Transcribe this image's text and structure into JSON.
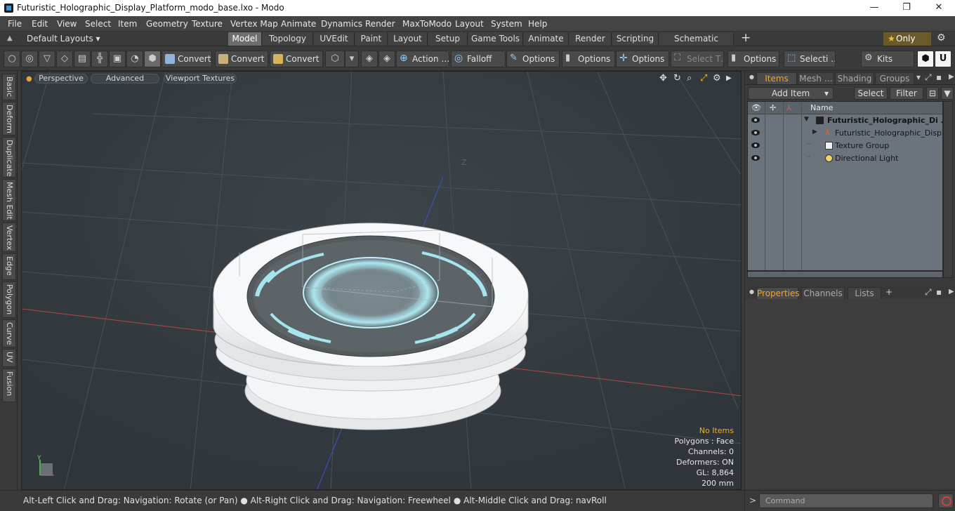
{
  "window": {
    "title": "Futuristic_Holographic_Display_Platform_modo_base.lxo - Modo",
    "minimize": "—",
    "restore": "❐",
    "close": "✕"
  },
  "menu": [
    "File",
    "Edit",
    "View",
    "Select",
    "Item",
    "Geometry",
    "Texture",
    "Vertex Map",
    "Animate",
    "Dynamics",
    "Render",
    "MaxToModo",
    "Layout",
    "System",
    "Help"
  ],
  "layout_bar": {
    "layouts_label": "Default Layouts ▾",
    "tabs": [
      "Model",
      "Topology",
      "UVEdit",
      "Paint",
      "Layout",
      "Setup",
      "Game Tools",
      "Animate",
      "Render",
      "Scripting",
      "Schematic Fusion"
    ],
    "active_tab": "Model",
    "add": "+",
    "only_label": "Only",
    "star": "★",
    "gear": "⚙"
  },
  "toolbar": {
    "buttons": [
      "Convert",
      "Convert",
      "Convert",
      "Action …",
      "Falloff",
      "Options",
      "Options",
      "Options",
      "Select T…",
      "Options",
      "Selecti …",
      "Kits"
    ]
  },
  "left_tabs": [
    "Basic",
    "Deform",
    "Duplicate",
    "Mesh Edit",
    "Vertex",
    "Edge",
    "Polygon",
    "Curve",
    "UV",
    "Fusion"
  ],
  "viewport": {
    "tabs": [
      "Perspective",
      "Advanced",
      "Viewport Textures"
    ],
    "axis_z_label": "Z",
    "axis_y_label": "Y",
    "info": {
      "no_items": "No Items",
      "polygons": "Polygons : Face",
      "channels": "Channels: 0",
      "deformers": "Deformers: ON",
      "gl": "GL: 8,864",
      "scale": "200 mm"
    }
  },
  "status_bar": "Alt-Left Click and Drag: Navigation: Rotate (or Pan) ● Alt-Right Click and Drag: Navigation: Freewheel ● Alt-Middle Click and Drag: navRoll",
  "items_panel": {
    "tabs": [
      "Items",
      "Mesh …",
      "Shading",
      "Groups"
    ],
    "active_tab": "Items",
    "add_item": "Add Item",
    "select": "Select",
    "filter": "Filter",
    "column_name": "Name",
    "rows": [
      {
        "name": "Futuristic_Holographic_Di …",
        "bold": true
      },
      {
        "name": "Futuristic_Holographic_Displ …",
        "bold": false
      },
      {
        "name": "Texture Group",
        "bold": false
      },
      {
        "name": "Directional Light",
        "bold": false
      }
    ]
  },
  "properties_panel": {
    "tabs": [
      "Properties",
      "Channels",
      "Lists"
    ],
    "active_tab": "Properties",
    "add": "+"
  },
  "command": {
    "prompt": ">",
    "placeholder": "Command"
  },
  "colors": {
    "accent_orange": "#f2a52a",
    "viewport_bg": "#333a40",
    "hologram_cyan": "#9ff3ff"
  }
}
